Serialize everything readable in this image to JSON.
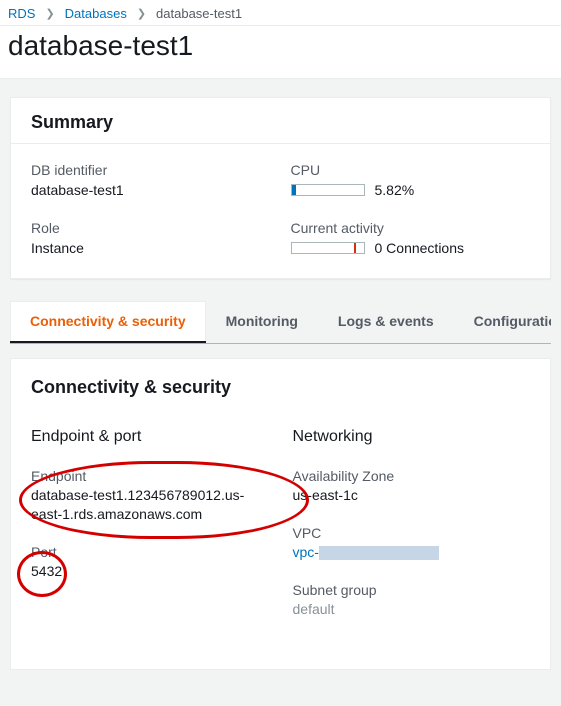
{
  "breadcrumb": {
    "root": "RDS",
    "level1": "Databases",
    "current": "database-test1"
  },
  "page_title": "database-test1",
  "summary": {
    "header": "Summary",
    "db_identifier_label": "DB identifier",
    "db_identifier_value": "database-test1",
    "cpu_label": "CPU",
    "cpu_value": "5.82%",
    "cpu_percent_fill": 6,
    "role_label": "Role",
    "role_value": "Instance",
    "activity_label": "Current activity",
    "activity_value": "0 Connections",
    "activity_tick_pos": 62
  },
  "tabs": {
    "t0": "Connectivity & security",
    "t1": "Monitoring",
    "t2": "Logs & events",
    "t3": "Configuration"
  },
  "detail": {
    "header": "Connectivity & security",
    "endpoint_port_header": "Endpoint & port",
    "endpoint_label": "Endpoint",
    "endpoint_value": "database-test1.123456789012.us-east-1.rds.amazonaws.com",
    "port_label": "Port",
    "port_value": "5432",
    "networking_header": "Networking",
    "az_label": "Availability Zone",
    "az_value": "us-east-1c",
    "vpc_label": "VPC",
    "vpc_link_prefix": "vpc-",
    "subnet_label": "Subnet group",
    "subnet_value": "default"
  }
}
